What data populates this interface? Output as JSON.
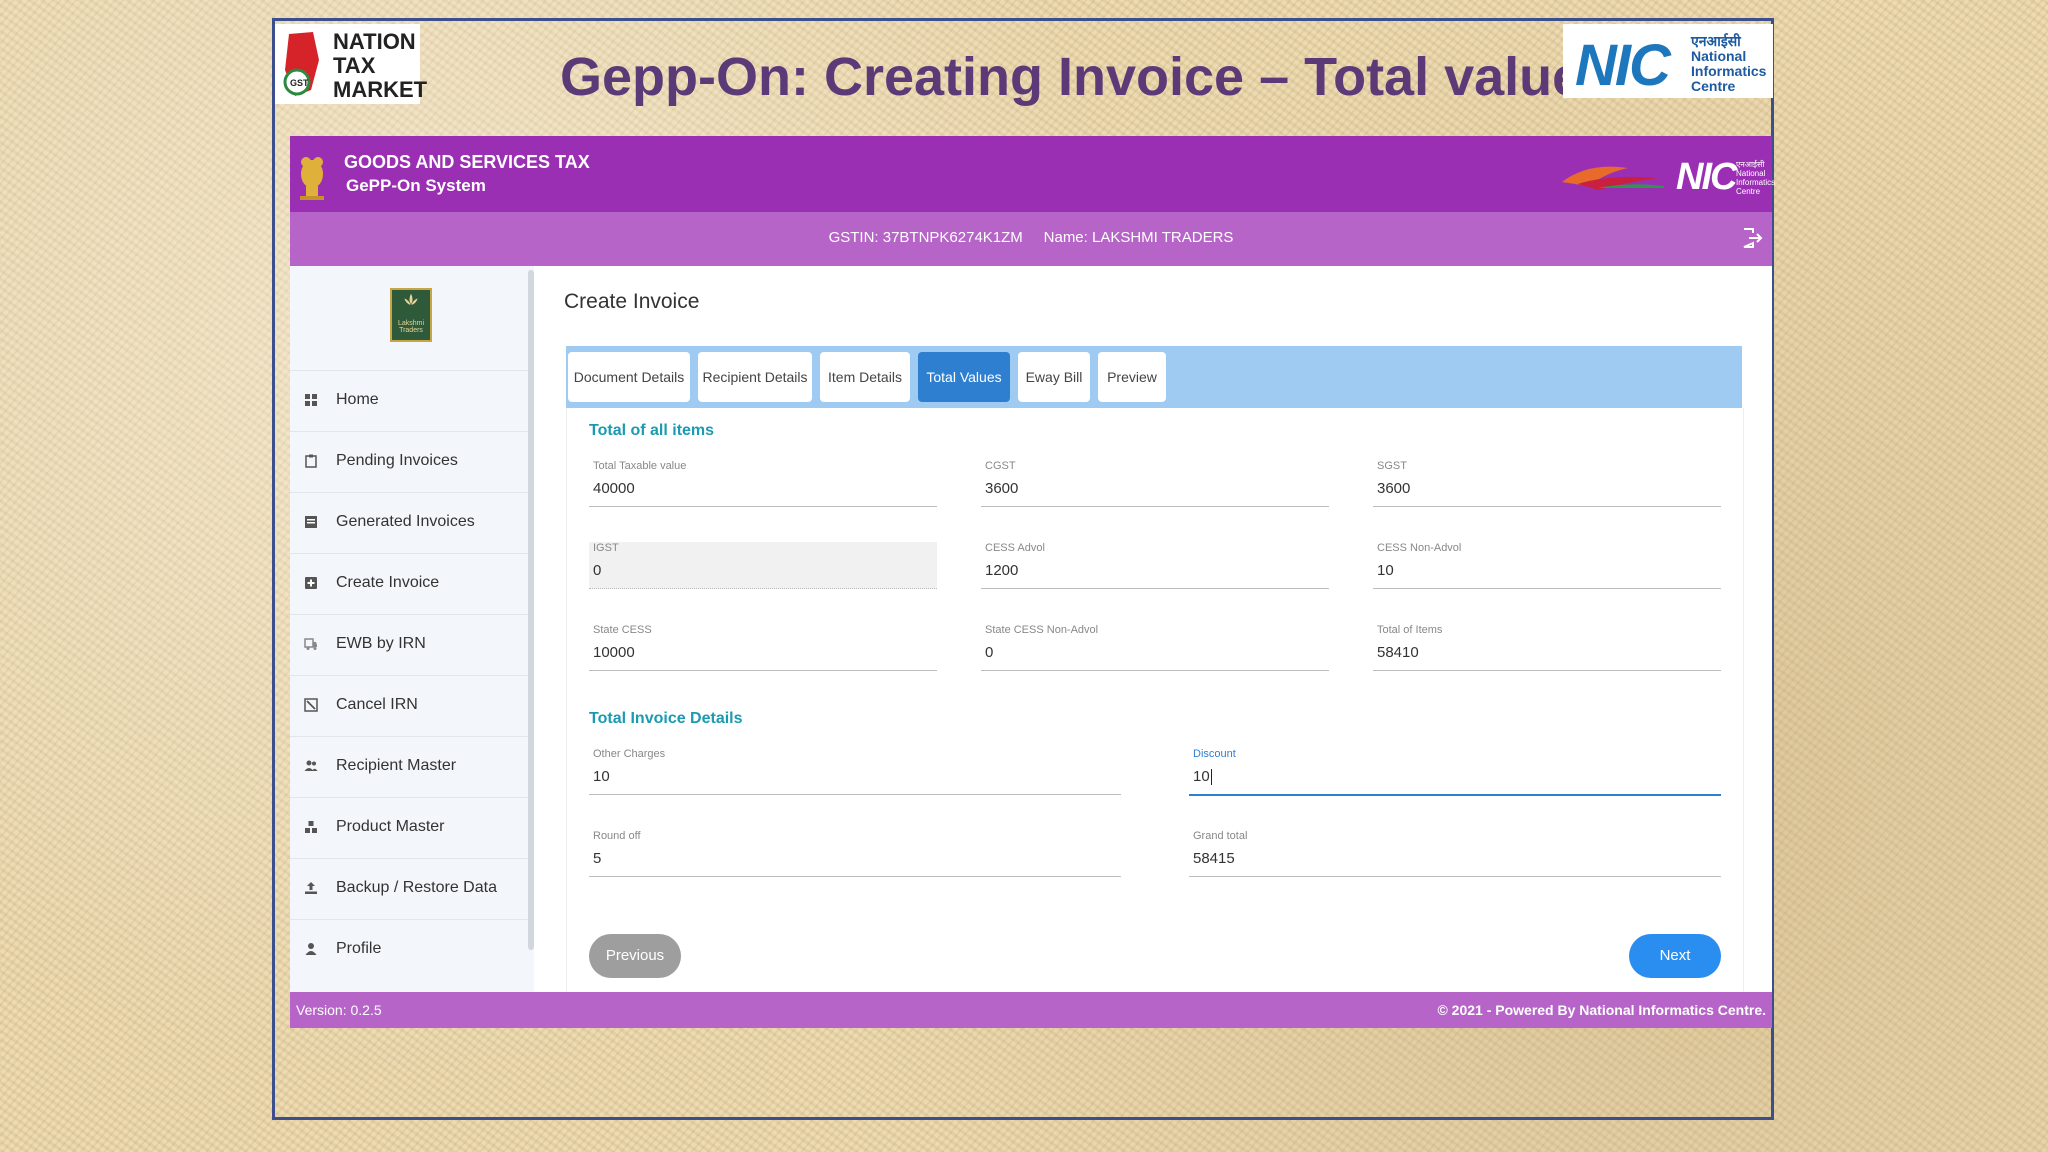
{
  "slide": {
    "title": "Gepp-On: Creating Invoice – Total values",
    "logo_left": {
      "lines": [
        "NATION",
        "TAX",
        "MARKET"
      ],
      "badge": "GST"
    },
    "logo_right": {
      "big": "NIC",
      "lines": [
        "एनआईसी",
        "National",
        "Informatics",
        "Centre"
      ]
    }
  },
  "header": {
    "title1": "GOODS AND SERVICES TAX",
    "title2": "GePP-On System",
    "nic": "NIC"
  },
  "subheader": {
    "info": "GSTIN: 37BTNPK6274K1ZM     Name: LAKSHMI TRADERS"
  },
  "sidebar": {
    "logo_text": "Lakshmi Traders",
    "items": [
      {
        "label": "Home",
        "icon": "home-icon"
      },
      {
        "label": "Pending Invoices",
        "icon": "clipboard-icon"
      },
      {
        "label": "Generated Invoices",
        "icon": "document-icon"
      },
      {
        "label": "Create Invoice",
        "icon": "plus-box-icon"
      },
      {
        "label": "EWB by IRN",
        "icon": "truck-icon"
      },
      {
        "label": "Cancel IRN",
        "icon": "cancel-icon"
      },
      {
        "label": "Recipient Master",
        "icon": "users-icon"
      },
      {
        "label": "Product Master",
        "icon": "boxes-icon"
      },
      {
        "label": "Backup / Restore Data",
        "icon": "backup-icon"
      },
      {
        "label": "Profile",
        "icon": "user-icon"
      }
    ]
  },
  "main": {
    "page_title": "Create Invoice",
    "tabs": [
      {
        "label": "Document Details",
        "active": false
      },
      {
        "label": "Recipient Details",
        "active": false
      },
      {
        "label": "Item Details",
        "active": false
      },
      {
        "label": "Total Values",
        "active": true
      },
      {
        "label": "Eway Bill",
        "active": false
      },
      {
        "label": "Preview",
        "active": false
      }
    ],
    "section1_title": "Total of all items",
    "fields1": [
      {
        "label": "Total Taxable value",
        "value": "40000"
      },
      {
        "label": "CGST",
        "value": "3600"
      },
      {
        "label": "SGST",
        "value": "3600"
      },
      {
        "label": "IGST",
        "value": "0"
      },
      {
        "label": "CESS Advol",
        "value": "1200"
      },
      {
        "label": "CESS Non-Advol",
        "value": "10"
      },
      {
        "label": "State CESS",
        "value": "10000"
      },
      {
        "label": "State CESS Non-Advol",
        "value": "0"
      },
      {
        "label": "Total of Items",
        "value": "58410"
      }
    ],
    "section2_title": "Total Invoice Details",
    "fields2": [
      {
        "label": "Other Charges",
        "value": "10"
      },
      {
        "label": "Discount",
        "value": "10"
      },
      {
        "label": "Round off",
        "value": "5"
      },
      {
        "label": "Grand total",
        "value": "58415"
      }
    ],
    "prev_label": "Previous",
    "next_label": "Next"
  },
  "footer": {
    "version": "Version: 0.2.5",
    "copyright": "© 2021 - Powered By National Informatics Centre."
  },
  "colors": {
    "header": "#9b2fb4",
    "subheader": "#b764c8",
    "tabbar": "#9fcbf2",
    "tab_active": "#2f7fd1",
    "section_title": "#1a9bb0",
    "next_button": "#2a8df0",
    "prev_button": "#9e9e9e",
    "slide_title": "#5c3a78"
  }
}
